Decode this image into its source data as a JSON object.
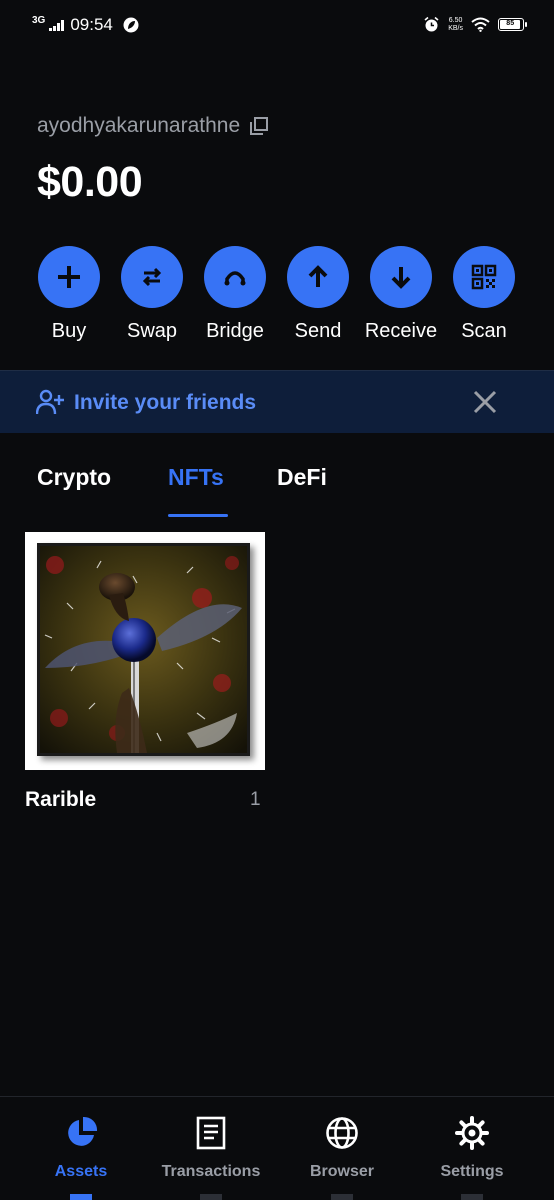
{
  "status_bar": {
    "network": "3G",
    "time": "09:54",
    "speed_value": "6.50",
    "speed_unit": "KB/s",
    "battery": "85"
  },
  "account": {
    "username": "ayodhyakarunarathne",
    "balance": "$0.00"
  },
  "actions": [
    {
      "label": "Buy",
      "icon": "plus-icon"
    },
    {
      "label": "Swap",
      "icon": "swap-icon"
    },
    {
      "label": "Bridge",
      "icon": "bridge-icon"
    },
    {
      "label": "Send",
      "icon": "arrow-up-icon"
    },
    {
      "label": "Receive",
      "icon": "arrow-down-icon"
    },
    {
      "label": "Scan",
      "icon": "qr-code-icon"
    }
  ],
  "invite_banner": {
    "text": "Invite your friends",
    "icon": "add-user-icon"
  },
  "tabs": [
    {
      "label": "Crypto",
      "active": false
    },
    {
      "label": "NFTs",
      "active": true
    },
    {
      "label": "DeFi",
      "active": false
    }
  ],
  "nft_collections": [
    {
      "name": "Rarible",
      "count": "1"
    }
  ],
  "bottom_nav": [
    {
      "label": "Assets",
      "icon": "pie-chart-icon",
      "active": true
    },
    {
      "label": "Transactions",
      "icon": "document-icon",
      "active": false
    },
    {
      "label": "Browser",
      "icon": "globe-icon",
      "active": false
    },
    {
      "label": "Settings",
      "icon": "gear-icon",
      "active": false
    }
  ],
  "colors": {
    "background": "#0a0b0d",
    "accent": "#3773f5",
    "banner_bg": "#0e1e3a",
    "banner_text": "#5a8cf6",
    "muted_text": "#9a9ea6"
  }
}
